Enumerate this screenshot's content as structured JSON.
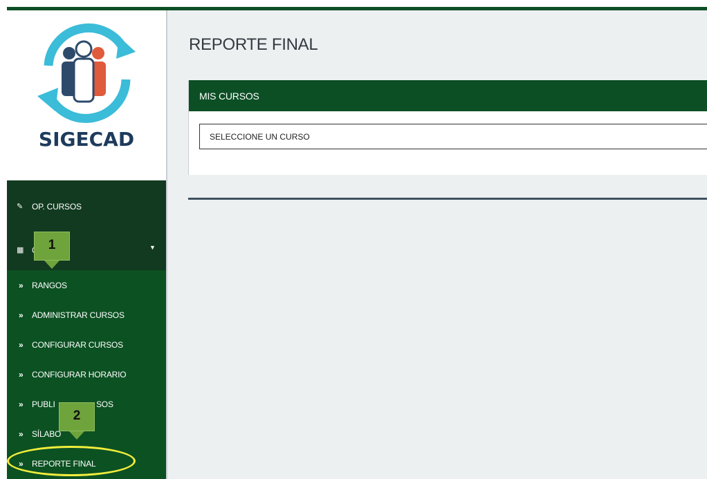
{
  "app": {
    "logo_text": "SIGECAD"
  },
  "sidebar": {
    "top_items": [
      {
        "icon": "pencil-icon",
        "label": "OP. CURSOS"
      },
      {
        "icon": "table-icon",
        "label": "C"
      }
    ],
    "sub_items": [
      {
        "icon": "double-chevron-right-icon",
        "label": "RANGOS"
      },
      {
        "icon": "double-chevron-right-icon",
        "label": "ADMINISTRAR CURSOS"
      },
      {
        "icon": "double-chevron-right-icon",
        "label": "CONFIGURAR CURSOS"
      },
      {
        "icon": "double-chevron-right-icon",
        "label": "CONFIGURAR HORARIO"
      },
      {
        "icon": "double-chevron-right-icon",
        "label": "PUBLI",
        "label_tail": "SOS"
      },
      {
        "icon": "double-chevron-right-icon",
        "label": "SÍLABO"
      },
      {
        "icon": "double-chevron-right-icon",
        "label": "REPORTE FINAL"
      }
    ]
  },
  "main": {
    "title": "REPORTE FINAL",
    "panel_title": "MIS CURSOS",
    "select_value": "SELECCIONE UN CURSO"
  },
  "callouts": [
    "1",
    "2"
  ],
  "colors": {
    "brand_green": "#0c4f25",
    "sidebar_dark": "#123a20",
    "sidebar_green": "#0c5122",
    "callout_green": "#6fa33c",
    "highlight_yellow": "#f1ed3c"
  }
}
